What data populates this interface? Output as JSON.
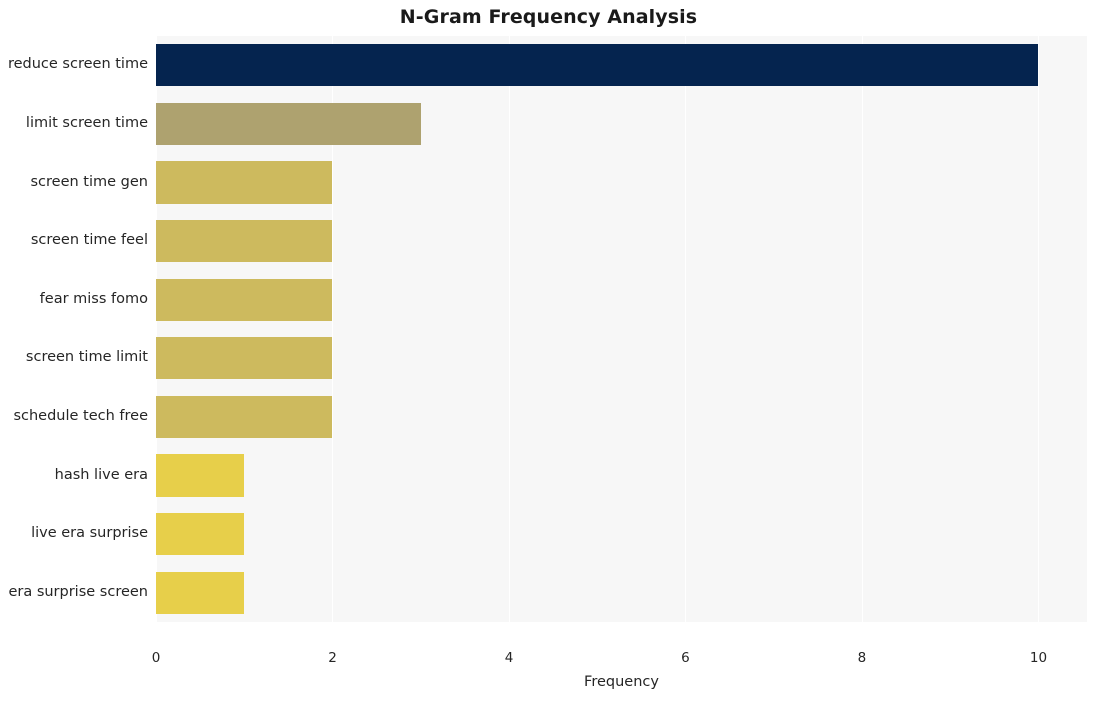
{
  "chart_data": {
    "type": "bar",
    "orientation": "horizontal",
    "title": "N-Gram Frequency Analysis",
    "xlabel": "Frequency",
    "ylabel": "",
    "categories": [
      "reduce screen time",
      "limit screen time",
      "screen time gen",
      "screen time feel",
      "fear miss fomo",
      "screen time limit",
      "schedule tech free",
      "hash live era",
      "live era surprise",
      "era surprise screen"
    ],
    "values": [
      10,
      3,
      2,
      2,
      2,
      2,
      2,
      1,
      1,
      1
    ],
    "bar_colors": [
      "#05244f",
      "#aea26f",
      "#cdba5e",
      "#cdba5e",
      "#cdba5e",
      "#cdba5e",
      "#cdba5e",
      "#e7cf4a",
      "#e7cf4a",
      "#e7cf4a"
    ],
    "xlim": [
      0,
      10.55
    ],
    "xticks": [
      0,
      2,
      4,
      6,
      8,
      10
    ],
    "xtick_labels": [
      "0",
      "2",
      "4",
      "6",
      "8",
      "10"
    ],
    "grid": true,
    "grid_axis": "x",
    "legend": "none",
    "plot_background": "#f7f7f7",
    "figure_background": "#ffffff"
  }
}
